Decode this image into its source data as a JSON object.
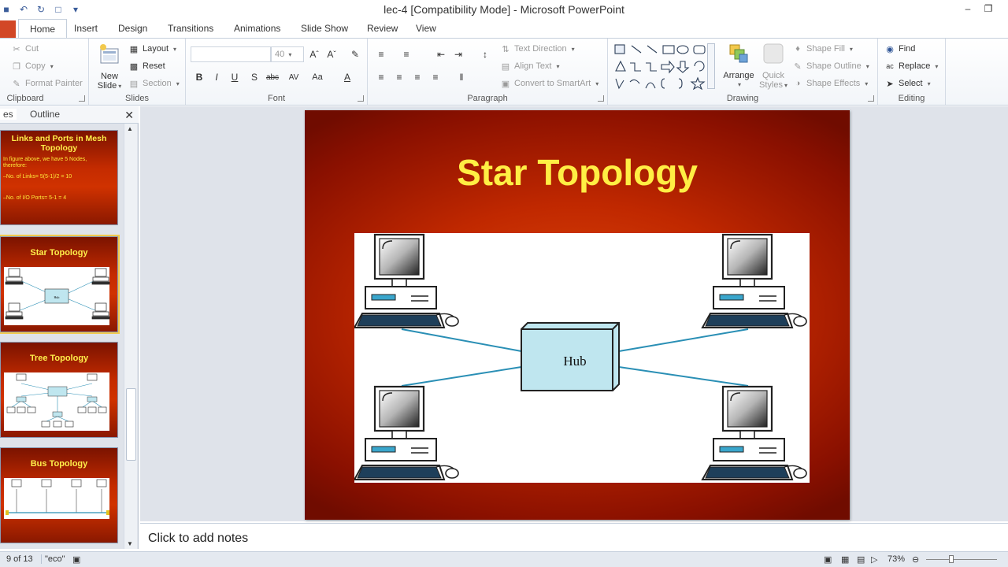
{
  "window": {
    "title": "lec-4 [Compatibility Mode] - Microsoft PowerPoint"
  },
  "tabs": {
    "home": "Home",
    "insert": "Insert",
    "design": "Design",
    "transitions": "Transitions",
    "animations": "Animations",
    "slideshow": "Slide Show",
    "review": "Review",
    "view": "View"
  },
  "ribbon": {
    "clipboard": {
      "label": "Clipboard",
      "cut": "Cut",
      "copy": "Copy",
      "format_painter": "Format Painter"
    },
    "slides": {
      "label": "Slides",
      "new_slide_1": "New",
      "new_slide_2": "Slide",
      "layout": "Layout",
      "reset": "Reset",
      "section": "Section"
    },
    "font": {
      "label": "Font",
      "size": "40"
    },
    "paragraph": {
      "label": "Paragraph",
      "text_direction": "Text Direction",
      "align_text": "Align Text",
      "convert_smartart": "Convert to SmartArt"
    },
    "drawing": {
      "label": "Drawing",
      "arrange": "Arrange",
      "quick_styles_1": "Quick",
      "quick_styles_2": "Styles",
      "shape_fill": "Shape Fill",
      "shape_outline": "Shape Outline",
      "shape_effects": "Shape Effects"
    },
    "editing": {
      "label": "Editing",
      "find": "Find",
      "replace": "Replace",
      "select": "Select"
    }
  },
  "left_panel": {
    "tab_slides": "es",
    "tab_outline": "Outline",
    "thumbnails": [
      {
        "title": "Links and Ports in Mesh Topology",
        "lines": [
          "In figure above, we have 5 Nodes,",
          "therefore:",
          "–No. of Links= 5(5-1)/2 = 10",
          "–No. of I/O Ports= 5-1 = 4"
        ]
      },
      {
        "title": "Star Topology",
        "hub_label": "Hub"
      },
      {
        "title": "Tree Topology"
      },
      {
        "title": "Bus Topology"
      }
    ]
  },
  "slide": {
    "title": "Star Topology",
    "hub_label": "Hub"
  },
  "notes": {
    "placeholder": "Click to add notes"
  },
  "status": {
    "slide_counter": "9 of 13",
    "theme": "\"eco\"",
    "zoom": "73%"
  },
  "colors": {
    "file_tab": "#d24726",
    "slide_title": "#ffee44",
    "hub_fill": "#bfe6ef",
    "link_line": "#2a8fb5"
  }
}
